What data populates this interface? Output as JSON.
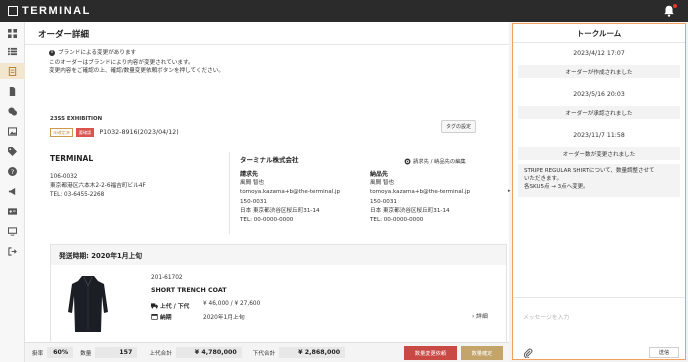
{
  "app": {
    "logo_text": "TERMINAL"
  },
  "sidebar": {
    "items": [
      "grid-icon",
      "list-icon",
      "order-icon",
      "document-icon",
      "chat-icon",
      "image-icon",
      "tag-icon",
      "help-icon",
      "megaphone-icon",
      "id-card-icon",
      "monitor-icon",
      "logout-icon"
    ]
  },
  "page": {
    "title": "オーダー詳細"
  },
  "notice": {
    "heading": "ブランドによる変更があります",
    "line1": "このオーダーはブランドにより内容が変更されています。",
    "line2": "変更内容をご確認の上、確認/数量変更依頼ボタンを押してください。"
  },
  "order": {
    "exhibition": "23SS EXHIBITION",
    "badge_unconfirmed": "未確定済",
    "badge_changed": "要確認",
    "po": "P1032-8916(2023/04/12)",
    "tag_button": "タグの設定"
  },
  "brand": {
    "name": "TERMINAL",
    "postal": "106-0032",
    "address": "東京都港区六本木2-2-6福吉町ビル4F",
    "tel": "TEL: 03-6455-2268"
  },
  "buyer": {
    "company": "ターミナル株式会社",
    "edit_link": "請求先 / 納品先の編集",
    "billing": {
      "heading": "請求先",
      "name": "風間 智也",
      "email": "tomoya.kazama+b@the-terminal.jp",
      "postal": "150-0031",
      "address": "日本 東京都渋谷区桜丘町31-14",
      "tel": "TEL: 00-0000-0000"
    },
    "shipping": {
      "heading": "納品先",
      "name": "風間 智也",
      "email": "tomoya.kazama+b@the-terminal.jp",
      "postal": "150-0031",
      "address": "日本 東京都渋谷区桜丘町31-14",
      "tel": "TEL: 00-0000-0000"
    }
  },
  "shipment": {
    "header": "発送時期: 2020年1月上旬",
    "item": {
      "sku": "201-61702",
      "name": "SHORT TRENCH COAT",
      "price_label": "上代 / 下代",
      "price_value": "¥ 46,000 / ¥ 27,600",
      "delivery_label": "納期",
      "delivery_value": "2020年1月上旬",
      "detail_link": "詳細",
      "color": "NAVY"
    }
  },
  "footer": {
    "rate_label": "掛率",
    "rate_value": "60%",
    "qty_label": "数量",
    "qty_value": "157",
    "upper_label": "上代合計",
    "upper_value": "¥ 4,780,000",
    "lower_label": "下代合計",
    "lower_value": "¥ 2,868,000",
    "change_button": "数量変更依頼",
    "confirm_button": "数量確定"
  },
  "talkroom": {
    "title": "トークルーム",
    "events": [
      {
        "date": "2023/4/12 17:07",
        "message": "オーダーが作成されました"
      },
      {
        "date": "2023/5/16 20:03",
        "message": "オーダーが承認されました"
      },
      {
        "date": "2023/11/7 11:58",
        "message": "オーダー数が変更されました"
      }
    ],
    "long_message": {
      "line1": "STRIPE REGULAR SHIRTについて、数量調整させて",
      "line2": "いただきます。",
      "line3": "各SKU5点 → 3点へ変更。"
    },
    "input_placeholder": "メッセージを入力",
    "send_button": "送信"
  },
  "colors": {
    "accent": "#c3a46b",
    "danger": "#c94a45",
    "highlight": "#f0a15a",
    "topbar": "#2b2b2b"
  }
}
